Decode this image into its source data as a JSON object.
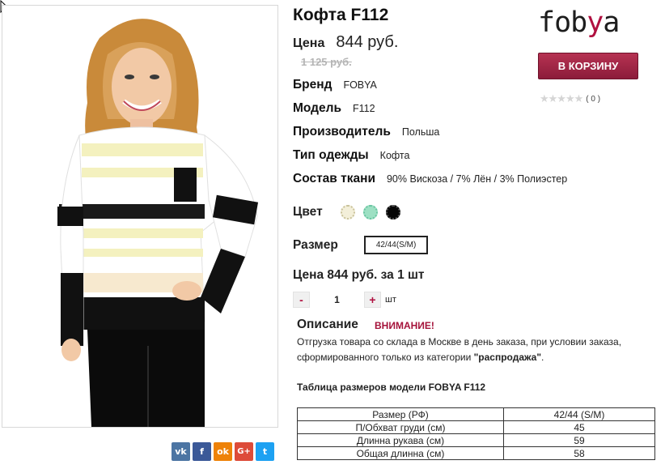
{
  "product": {
    "title": "Кофта F112",
    "price_label": "Цена",
    "price": "844 руб.",
    "old_price": "1 125 руб.",
    "attributes": [
      {
        "label": "Бренд",
        "value": "FOBYA"
      },
      {
        "label": "Модель",
        "value": "F112"
      },
      {
        "label": "Производитель",
        "value": "Польша"
      },
      {
        "label": "Тип одежды",
        "value": "Кофта"
      },
      {
        "label": "Состав ткани",
        "value": "90% Вискоза / 7% Лён / 3% Полиэстер"
      }
    ],
    "color_label": "Цвет",
    "colors": [
      "#f3efd9",
      "#9de0c3",
      "#050505"
    ],
    "size_label": "Размер",
    "size_selected": "42/44(S/M)",
    "line_price": "Цена 844 руб. за 1 шт",
    "quantity": {
      "minus": "-",
      "value": "1",
      "plus": "+",
      "unit": "шт"
    }
  },
  "description": {
    "title": "Описание",
    "warning": "ВНИМАНИЕ!",
    "text_prefix": "Отгрузка товара со склада в Москве в день заказа, при условии заказа, сформированного только из категории ",
    "text_bold": "\"распродажа\"",
    "text_suffix": "."
  },
  "size_table": {
    "title": "Таблица размеров модели FOBYA F112",
    "rows": [
      [
        "Размер (РФ)",
        "42/44 (S/M)"
      ],
      [
        "П/Обхват груди (см)",
        "45"
      ],
      [
        "Длинна рукава (см)",
        "59"
      ],
      [
        "Общая длинна (см)",
        "58"
      ]
    ]
  },
  "header": {
    "logo_text_1": "fob",
    "logo_text_2": "y",
    "logo_text_3": "a",
    "cart_button": "В КОРЗИНУ",
    "rating_stars": "★★★★★",
    "rating_count": "( 0 )"
  },
  "share": {
    "buttons": [
      {
        "icon": "vk-icon",
        "glyph": "vk"
      },
      {
        "icon": "facebook-icon",
        "glyph": "f"
      },
      {
        "icon": "odnoklassniki-icon",
        "glyph": "ok"
      },
      {
        "icon": "google-plus-icon",
        "glyph": "G+"
      },
      {
        "icon": "twitter-icon",
        "glyph": "t"
      }
    ]
  },
  "colors": {
    "accent": "#a5123a",
    "cart_button": "#9e2746"
  }
}
